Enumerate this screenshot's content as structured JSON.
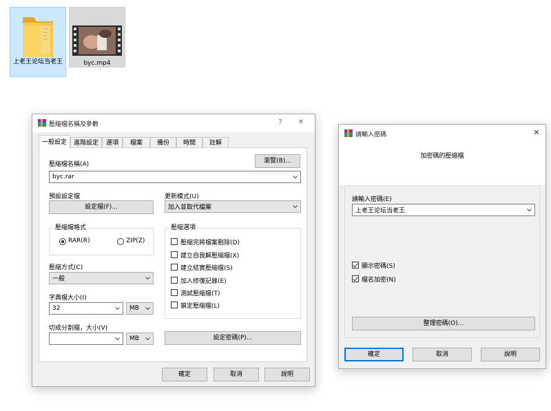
{
  "desktop": {
    "folder_label": "上老王论坛当老王",
    "video_label": "byc.mp4"
  },
  "archive_dialog": {
    "title": "壓縮檔名稱及參數",
    "help": "?",
    "close": "✕",
    "tabs": [
      "一般設定",
      "進階設定",
      "選項",
      "檔案",
      "備份",
      "時間",
      "註解"
    ],
    "archive_name_label": "壓縮檔名稱(A)",
    "browse_button": "瀏覽(B)...",
    "archive_name_value": "byc.rar",
    "profile_label": "預設設定檔",
    "profile_button": "設定檔(F)...",
    "update_mode_label": "更新模式(U)",
    "update_mode_value": "加入並取代檔案",
    "format_group": "壓縮檔格式",
    "format_rar": "RAR(R)",
    "format_zip": "ZIP(Z)",
    "options_group": "壓縮選項",
    "options": [
      "壓縮完將檔案刪除(D)",
      "建立自我解壓縮檔(X)",
      "建立結實壓縮檔(S)",
      "加入修復記錄(E)",
      "測試壓縮檔(T)",
      "鎖定壓縮檔(L)"
    ],
    "method_label": "壓縮方式(C)",
    "method_value": "一般",
    "dict_label": "字典檔大小(I)",
    "dict_value": "32",
    "dict_unit": "MB",
    "split_label": "切成分割檔，大小(V)",
    "split_value": "",
    "split_unit": "MB",
    "set_password_button": "設定密碼(P)...",
    "ok": "確定",
    "cancel": "取消",
    "help_button": "說明"
  },
  "password_dialog": {
    "title": "請輸入密碼",
    "close": "✕",
    "header": "加密碼的壓縮檔",
    "enter_label": "請輸入密碼(E)",
    "password_value": "上老王论坛当老王",
    "show_password": "顯示密碼(S)",
    "encrypt_names": "檔名加密(N)",
    "organize_button": "整理密碼(O)...",
    "ok": "確定",
    "cancel": "取消",
    "help_button": "說明"
  }
}
